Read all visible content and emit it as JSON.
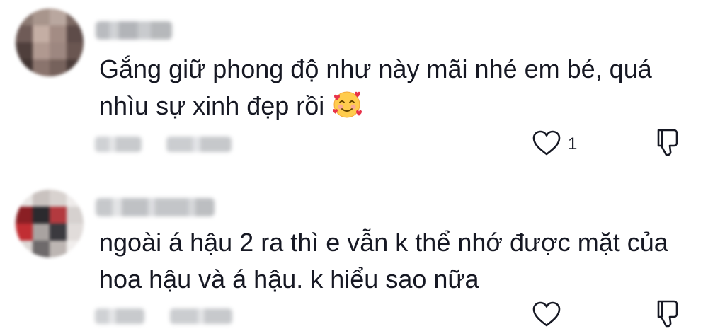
{
  "comments": [
    {
      "text_line1": "Gắng giữ phong độ như này mãi nhé em bé, quá",
      "text_line2": "nhìu sự xinh đẹp rồi",
      "emoji": "smiling-face-with-hearts",
      "like_count": "1"
    },
    {
      "text_line1": "ngoài á hậu 2 ra thì e vẫn k thể nhớ được mặt của",
      "text_line2": "hoa hậu và á hậu. k hiểu sao nữa",
      "like_count": ""
    }
  ],
  "icons": {
    "like": "heart-outline-icon",
    "dislike": "thumbs-down-outline-icon"
  },
  "colors": {
    "text": "#161823",
    "icon_stroke": "#161823",
    "blurred_meta": "#c8cacd"
  }
}
